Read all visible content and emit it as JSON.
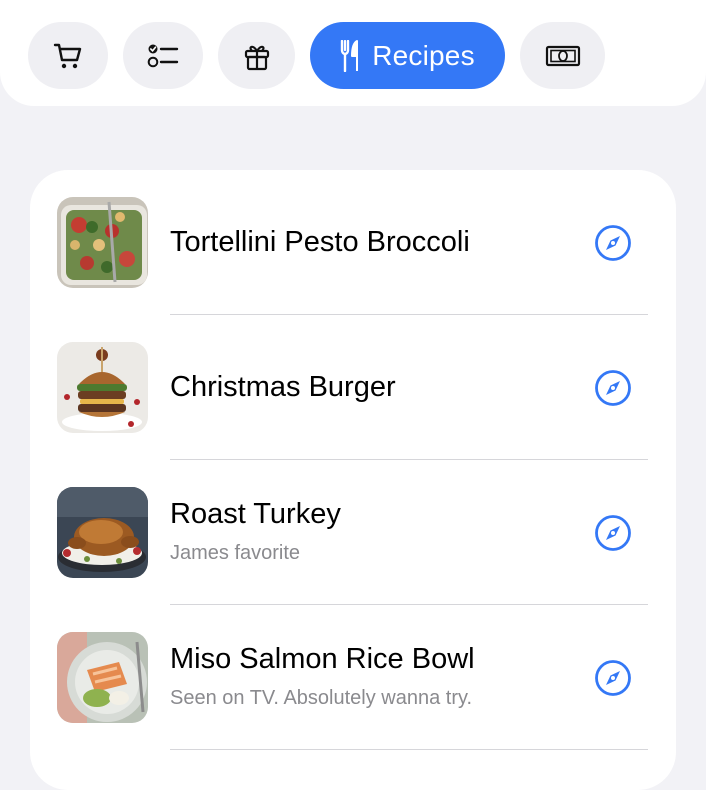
{
  "toolbar": {
    "items": [
      {
        "icon": "cart-icon"
      },
      {
        "icon": "checklist-icon"
      },
      {
        "icon": "gift-icon"
      },
      {
        "icon": "fork-knife-icon",
        "label": "Recipes",
        "active": true
      },
      {
        "icon": "banknote-icon"
      }
    ]
  },
  "colors": {
    "accent": "#3478f6",
    "background": "#f2f2f6",
    "card": "#ffffff",
    "secondary_text": "#8a8a8e"
  },
  "recipes": [
    {
      "title": "Tortellini Pesto Broccoli",
      "note": "",
      "action_icon": "compass-icon"
    },
    {
      "title": "Christmas Burger",
      "note": "",
      "action_icon": "compass-icon"
    },
    {
      "title": "Roast Turkey",
      "note": "James favorite",
      "action_icon": "compass-icon"
    },
    {
      "title": "Miso Salmon Rice Bowl",
      "note": "Seen on TV. Absolutely wanna try.",
      "action_icon": "compass-icon"
    }
  ]
}
